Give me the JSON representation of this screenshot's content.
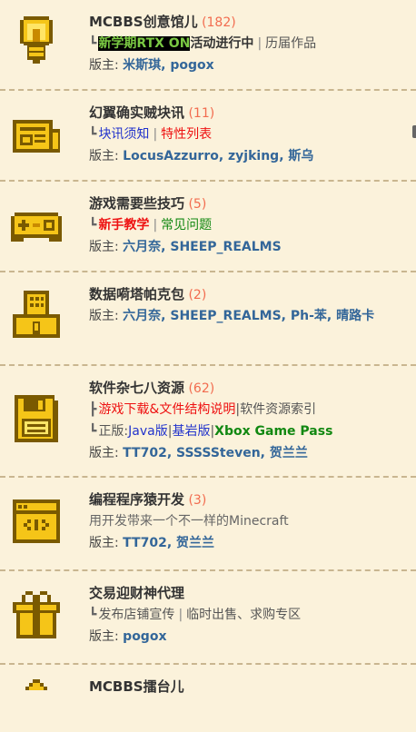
{
  "forums": [
    {
      "name": "MCBBS创意馆儿",
      "count": "(182)",
      "icon": "lightbulb-icon",
      "tree": "┗",
      "links": [
        {
          "text": "新学期RTX ON",
          "style": "hl-black"
        },
        {
          "text": "活动进行中",
          "style": "bold-dark"
        },
        {
          "text": "|",
          "style": "sep"
        },
        {
          "text": "历届作品",
          "style": "plain"
        }
      ],
      "moderator_label": "版主:",
      "moderators": "米斯琪, pogox"
    },
    {
      "name": "幻翼确实贼块讯",
      "count": "(11)",
      "icon": "newspaper-icon",
      "tree": "┗",
      "links": [
        {
          "text": "块讯须知",
          "style": "link-blue"
        },
        {
          "text": "|",
          "style": "sep"
        },
        {
          "text": "特性列表",
          "style": "link-red"
        }
      ],
      "moderator_label": "版主:",
      "moderators": "LocusAzzurro, zyjking, 斯乌"
    },
    {
      "name": "游戏需要些技巧",
      "count": "(5)",
      "icon": "gamepad-icon",
      "tree": "┗",
      "links": [
        {
          "text": "新手教学",
          "style": "link-red-bold"
        },
        {
          "text": "|",
          "style": "sep"
        },
        {
          "text": "常见问题",
          "style": "link-green"
        }
      ],
      "moderator_label": "版主:",
      "moderators": "六月奈, SHEEP_REALMS"
    },
    {
      "name": "数据嗬塔帕克包",
      "count": "(2)",
      "icon": "package-icon",
      "moderator_label": "版主:",
      "moderators": "六月奈, SHEEP_REALMS, Ph-苯, 晴路卡"
    },
    {
      "name": "软件杂七八资源",
      "count": "(62)",
      "icon": "floppy-disk-icon",
      "sublines": [
        {
          "tree": "┣",
          "links": [
            {
              "text": "游戏下载&文件结构说明",
              "style": "link-red"
            },
            {
              "text": "|软件资源索引",
              "style": "plain"
            }
          ]
        },
        {
          "tree": "┗",
          "links": [
            {
              "text": "正版:",
              "style": "plain"
            },
            {
              "text": "Java版",
              "style": "link-blue"
            },
            {
              "text": "|",
              "style": "plain"
            },
            {
              "text": "基岩版",
              "style": "link-blue"
            },
            {
              "text": "|",
              "style": "plain"
            },
            {
              "text": "Xbox Game Pass",
              "style": "link-green-bold"
            }
          ]
        }
      ],
      "moderator_label": "版主:",
      "moderators": "TT702, SSSSSteven, 贺兰兰"
    },
    {
      "name": "编程程序猿开发",
      "count": "(3)",
      "icon": "code-window-icon",
      "description": "用开发带来一个不一样的Minecraft",
      "moderator_label": "版主:",
      "moderators": "TT702, 贺兰兰"
    },
    {
      "name": "交易迎财神代理",
      "count": "",
      "icon": "gift-box-icon",
      "tree": "┗",
      "links": [
        {
          "text": "发布店铺宣传",
          "style": "plain"
        },
        {
          "text": "|",
          "style": "sep"
        },
        {
          "text": "临时出售、求购专区",
          "style": "plain"
        }
      ],
      "moderator_label": "版主:",
      "moderators": "pogox"
    },
    {
      "name": "MCBBS擂台儿",
      "count": "",
      "icon": "house-icon"
    }
  ]
}
